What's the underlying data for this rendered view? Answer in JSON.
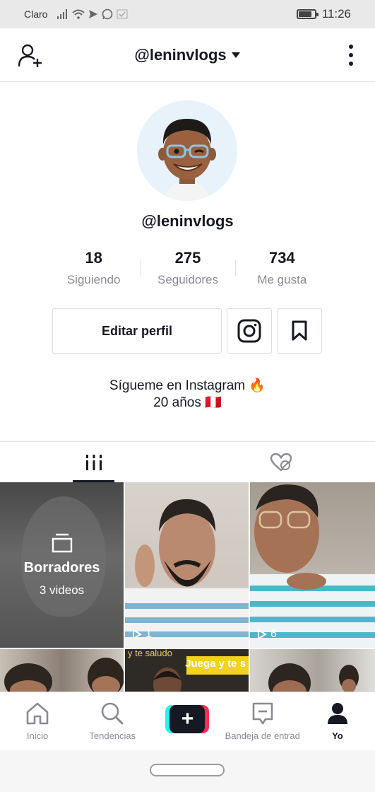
{
  "status_bar": {
    "carrier": "Claro",
    "time": "11:26",
    "battery_level": 0.85,
    "icons": [
      "signal-icon",
      "wifi-icon",
      "send-icon",
      "whatsapp-icon",
      "check-icon"
    ]
  },
  "header": {
    "title": "@leninvlogs",
    "icons": {
      "add_user": "add-user-icon",
      "dropdown": "caret-down-icon",
      "more": "more-vertical-icon"
    }
  },
  "profile": {
    "username": "@leninvlogs",
    "stats": [
      {
        "value": "18",
        "label": "Siguiendo"
      },
      {
        "value": "275",
        "label": "Seguidores"
      },
      {
        "value": "734",
        "label": "Me gusta"
      }
    ],
    "edit_label": "Editar perfil",
    "bio_line1": "Sígueme en Instagram 🔥",
    "bio_line2": "20 años 🇵🇪"
  },
  "tabs": {
    "items": [
      {
        "name": "videos",
        "icon": "grid-icon",
        "active": true
      },
      {
        "name": "liked",
        "icon": "liked-hidden-icon",
        "active": false
      }
    ]
  },
  "grid": {
    "drafts": {
      "title": "Borradores",
      "count": "3 videos"
    },
    "videos": [
      {
        "plays": "1"
      },
      {
        "plays": "6"
      }
    ],
    "thumb_text": {
      "left": "y te saludo",
      "right": "Juega y te s"
    }
  },
  "bottom_nav": {
    "items": [
      {
        "label": "Inicio",
        "icon": "home-icon"
      },
      {
        "label": "Tendencias",
        "icon": "search-icon"
      },
      {
        "label": "",
        "icon": "plus-icon"
      },
      {
        "label": "Bandeja de entrad",
        "icon": "inbox-icon"
      },
      {
        "label": "Yo",
        "icon": "profile-icon",
        "active": true
      }
    ]
  },
  "colors": {
    "text": "#161823",
    "muted": "#8a8b91",
    "border": "#e3e3e4",
    "accent_cyan": "#25f4ee",
    "accent_pink": "#fe2c55"
  }
}
